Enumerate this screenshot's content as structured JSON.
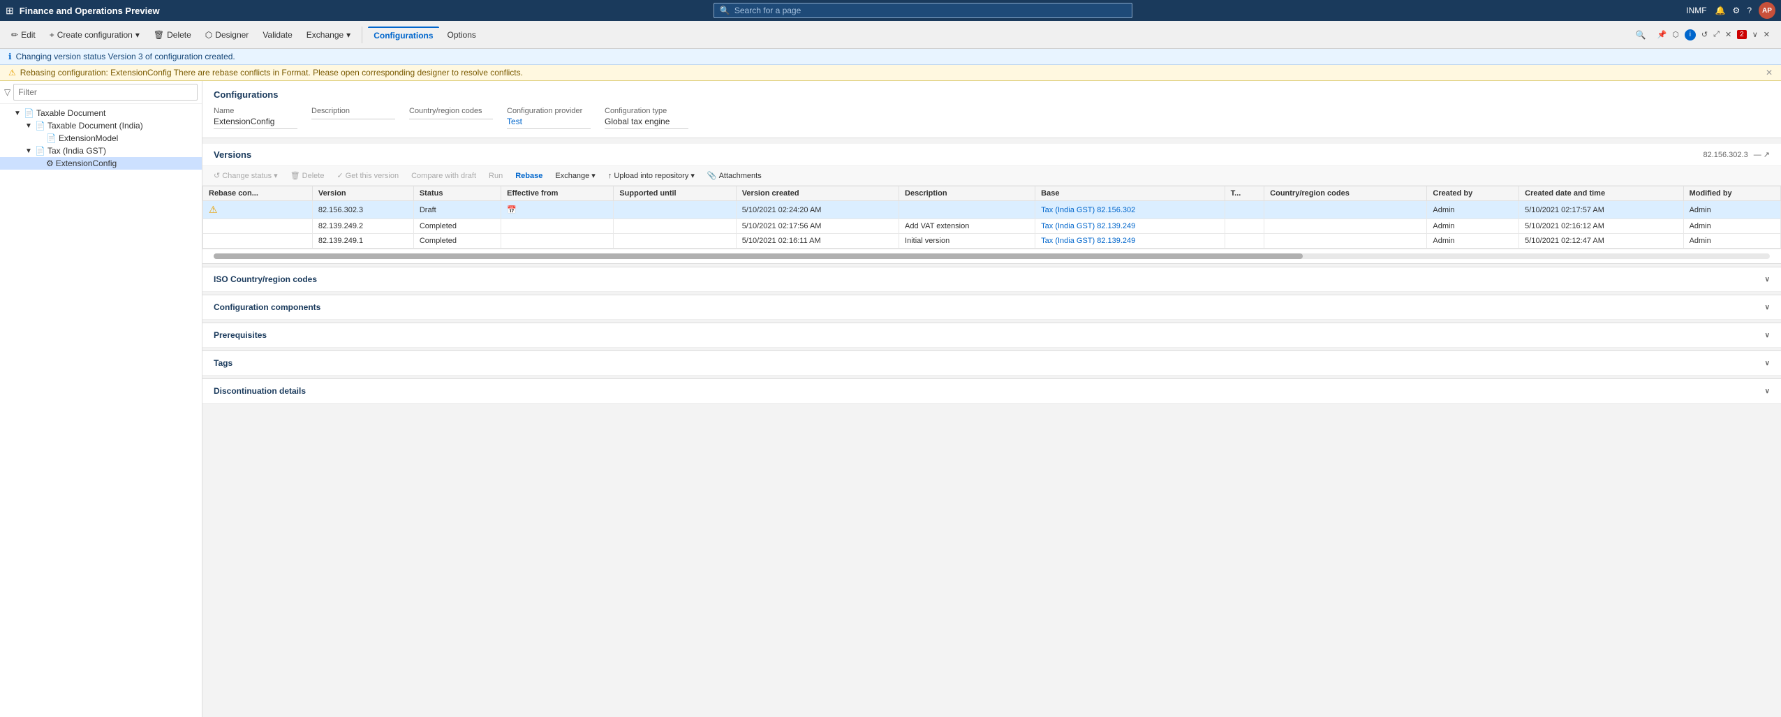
{
  "app": {
    "title": "Finance and Operations Preview",
    "user_initials": "AP",
    "search_placeholder": "Search for a page"
  },
  "top_bar": {
    "right_items": [
      "INMF"
    ],
    "icons": [
      "bell",
      "settings",
      "help",
      "avatar"
    ]
  },
  "ribbon": {
    "buttons": [
      {
        "label": "Edit",
        "icon": "✏️"
      },
      {
        "label": "Create configuration",
        "icon": "+",
        "dropdown": true
      },
      {
        "label": "Delete",
        "icon": "🗑"
      },
      {
        "label": "Designer",
        "icon": "⬡"
      },
      {
        "label": "Validate"
      },
      {
        "label": "Exchange",
        "dropdown": true
      },
      {
        "label": "Configurations",
        "active": true
      },
      {
        "label": "Options"
      }
    ],
    "search_icon": "🔍"
  },
  "info_bars": [
    {
      "type": "blue",
      "icon": "ℹ",
      "text": "Changing version status  Version 3 of configuration created."
    },
    {
      "type": "yellow",
      "icon": "⚠",
      "text": "Rebasing configuration: ExtensionConfig  There are rebase conflicts in Format. Please open corresponding designer to resolve conflicts."
    }
  ],
  "sidebar": {
    "filter_placeholder": "Filter",
    "tree": [
      {
        "label": "Taxable Document",
        "level": 0,
        "expanded": true,
        "icon": "▶"
      },
      {
        "label": "Taxable Document (India)",
        "level": 1,
        "expanded": true,
        "icon": "▶"
      },
      {
        "label": "ExtensionModel",
        "level": 2,
        "icon": ""
      },
      {
        "label": "Tax (India GST)",
        "level": 2,
        "expanded": true,
        "icon": "▶"
      },
      {
        "label": "ExtensionConfig",
        "level": 3,
        "icon": "",
        "selected": true
      }
    ]
  },
  "config": {
    "section_title": "Configurations",
    "fields": [
      {
        "label": "Name",
        "value": "ExtensionConfig",
        "link": false
      },
      {
        "label": "Description",
        "value": "",
        "link": false
      },
      {
        "label": "Country/region codes",
        "value": "",
        "link": false
      },
      {
        "label": "Configuration provider",
        "value": "Test",
        "link": true
      },
      {
        "label": "Configuration type",
        "value": "Global tax engine",
        "link": false
      }
    ]
  },
  "versions": {
    "title": "Versions",
    "count": "82.156.302.3",
    "action_buttons": [
      {
        "label": "Change status",
        "dropdown": true,
        "disabled": false
      },
      {
        "label": "Delete",
        "disabled": false
      },
      {
        "label": "Get this version",
        "disabled": false
      },
      {
        "label": "Compare with draft",
        "disabled": false
      },
      {
        "label": "Run",
        "disabled": false
      },
      {
        "label": "Rebase",
        "blue": true
      },
      {
        "label": "Exchange",
        "dropdown": true
      },
      {
        "label": "Upload into repository",
        "dropdown": true
      },
      {
        "label": "Attachments",
        "icon": "📎"
      }
    ],
    "columns": [
      "Rebase con...",
      "Version",
      "Status",
      "Effective from",
      "Supported until",
      "Version created",
      "Description",
      "Base",
      "T...",
      "Country/region codes",
      "Created by",
      "Created date and time",
      "Modified by"
    ],
    "rows": [
      {
        "rebase": "⚠",
        "version": "82.156.302.3",
        "status": "Draft",
        "effective_from": "",
        "supported_until": "",
        "version_created": "5/10/2021 02:24:20 AM",
        "description": "",
        "base": "Tax (India GST)  82.156.302",
        "t": "",
        "country": "",
        "created_by": "Admin",
        "created_date": "5/10/2021 02:17:57 AM",
        "modified_by": "Admin",
        "highlighted": true
      },
      {
        "rebase": "",
        "version": "82.139.249.2",
        "status": "Completed",
        "effective_from": "",
        "supported_until": "",
        "version_created": "5/10/2021 02:17:56 AM",
        "description": "Add VAT extension",
        "base": "Tax (India GST)  82.139.249",
        "t": "",
        "country": "",
        "created_by": "Admin",
        "created_date": "5/10/2021 02:16:12 AM",
        "modified_by": "Admin",
        "highlighted": false
      },
      {
        "rebase": "",
        "version": "82.139.249.1",
        "status": "Completed",
        "effective_from": "",
        "supported_until": "",
        "version_created": "5/10/2021 02:16:11 AM",
        "description": "Initial version",
        "base": "Tax (India GST)  82.139.249",
        "t": "",
        "country": "",
        "created_by": "Admin",
        "created_date": "5/10/2021 02:12:47 AM",
        "modified_by": "Admin",
        "highlighted": false
      }
    ]
  },
  "collapsible_sections": [
    {
      "label": "ISO Country/region codes"
    },
    {
      "label": "Configuration components"
    },
    {
      "label": "Prerequisites"
    },
    {
      "label": "Tags"
    },
    {
      "label": "Discontinuation details"
    }
  ]
}
